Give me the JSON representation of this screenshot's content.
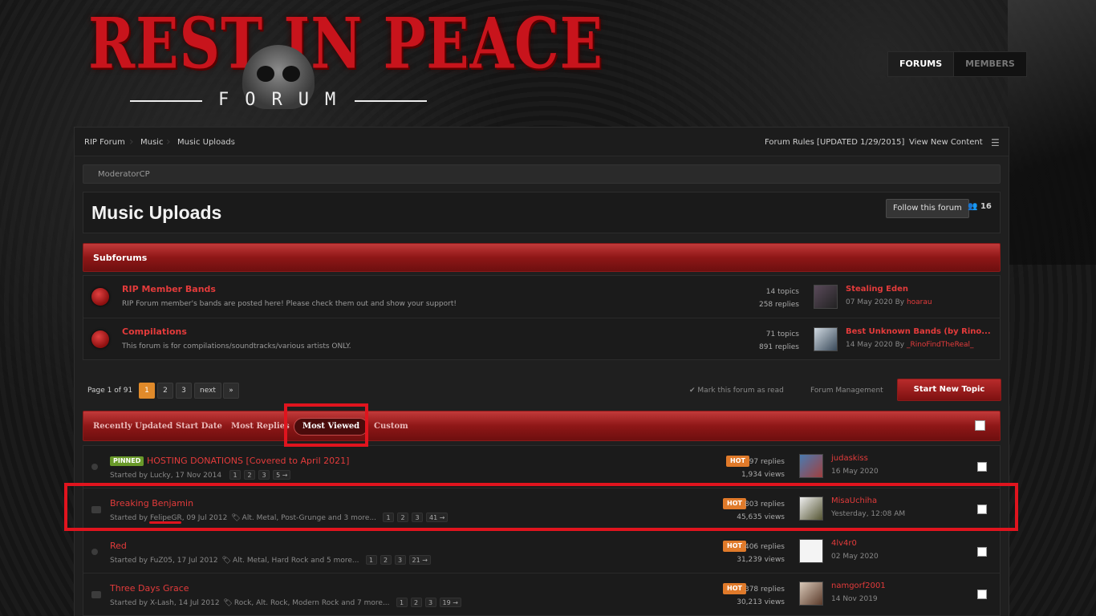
{
  "logo": {
    "title": "REST IN PEACE",
    "subtitle": "FORUM"
  },
  "topnav": {
    "forums": "FORUMS",
    "members": "MEMBERS"
  },
  "breadcrumbs": [
    "RIP Forum",
    "Music",
    "Music Uploads"
  ],
  "header_links": {
    "rules": "Forum Rules [UPDATED 1/29/2015]",
    "view_new": "View New Content"
  },
  "modcp": "ModeratorCP",
  "page": {
    "title": "Music Uploads",
    "follow_label": "Follow this forum",
    "followers": "16"
  },
  "subforums": {
    "heading": "Subforums",
    "items": [
      {
        "name": "RIP Member Bands",
        "desc": "RIP Forum member's bands are posted here! Please check them out and show your support!",
        "topics": "14 topics",
        "replies": "258 replies",
        "last_title": "Stealing Eden",
        "last_date": "07 May 2020",
        "by": "By",
        "last_user": "hoarau"
      },
      {
        "name": "Compilations",
        "desc": "This forum is for compilations/soundtracks/various artists ONLY.",
        "topics": "71 topics",
        "replies": "891 replies",
        "last_title": "Best Unknown Bands (by Rino...",
        "last_date": "14 May 2020",
        "by": "By",
        "last_user": "_RinoFindTheReal_"
      }
    ]
  },
  "pagination": {
    "info": "Page 1 of 91",
    "pages": [
      "1",
      "2",
      "3"
    ],
    "next": "next",
    "last": "»",
    "mark_read": "Mark this forum as read",
    "forum_mgmt": "Forum Management",
    "start_topic": "Start New Topic"
  },
  "sort": {
    "recent": "Recently Updated",
    "start": "Start Date",
    "replies": "Most Replies",
    "viewed": "Most Viewed",
    "custom": "Custom"
  },
  "topics": [
    {
      "pinned": "PINNED",
      "title": "HOSTING DONATIONS [Covered to April 2021]",
      "started": "Started by Lucky, 17 Nov 2014",
      "tags": "",
      "pages": [
        "1",
        "2",
        "3",
        "5 →"
      ],
      "hot": "HOT",
      "replies": "97 replies",
      "views": "1,934 views",
      "last_user": "judaskiss",
      "last_date": "16 May 2020"
    },
    {
      "pinned": "",
      "title": "Breaking Benjamin",
      "started": "Started by FelipeGR, 09 Jul 2012",
      "tags": "Alt. Metal, Post-Grunge and 3 more...",
      "pages": [
        "1",
        "2",
        "3",
        "41 →"
      ],
      "hot": "HOT",
      "replies": "803 replies",
      "views": "45,635 views",
      "last_user": "MisaUchiha",
      "last_date": "Yesterday, 12:08 AM"
    },
    {
      "pinned": "",
      "title": "Red",
      "started": "Started by FuZ05, 17 Jul 2012",
      "tags": "Alt. Metal, Hard Rock and 5 more...",
      "pages": [
        "1",
        "2",
        "3",
        "21 →"
      ],
      "hot": "HOT",
      "replies": "406 replies",
      "views": "31,239 views",
      "last_user": "4lv4r0",
      "last_date": "02 May 2020"
    },
    {
      "pinned": "",
      "title": "Three Days Grace",
      "started": "Started by X-Lash, 14 Jul 2012",
      "tags": "Rock, Alt. Rock, Modern Rock and 7 more...",
      "pages": [
        "1",
        "2",
        "3",
        "19 →"
      ],
      "hot": "HOT",
      "replies": "378 replies",
      "views": "30,213 views",
      "last_user": "namgorf2001",
      "last_date": "14 Nov 2019"
    }
  ],
  "colors": {
    "accent_red": "#e33b3b",
    "hot_orange": "#e07a2a",
    "current_page": "#e08a2a",
    "annotation": "#e0141e"
  }
}
